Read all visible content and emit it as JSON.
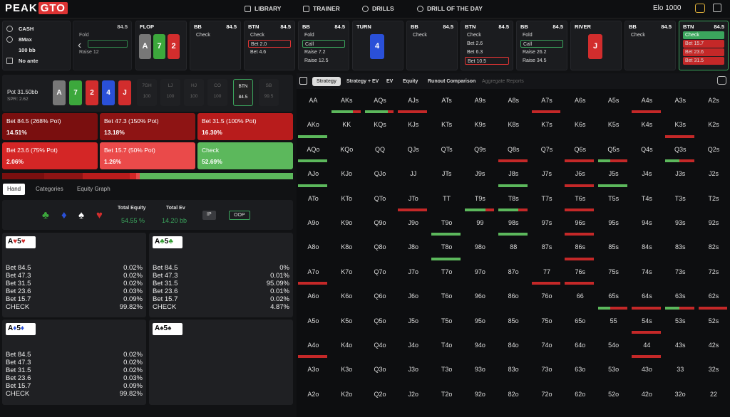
{
  "nav": {
    "logo_left": "PEAK",
    "logo_right": "GTO",
    "items": [
      "LIBRARY",
      "TRAINER",
      "DRILLS",
      "DRILL OF THE DAY"
    ],
    "elo_label": "Elo 1000"
  },
  "game_info": {
    "type": "CASH",
    "players": "8Max",
    "stack": "100 bb",
    "ante": "No ante"
  },
  "tiles": [
    {
      "pos": "",
      "stack": "84.5",
      "actions": [
        "Fold",
        "",
        "Raise 12"
      ]
    },
    {
      "pos": "FLOP",
      "stack": "",
      "cards": [
        "A",
        "7",
        "2"
      ]
    },
    {
      "pos": "BB",
      "stack": "84.5",
      "actions": [
        "Check"
      ]
    },
    {
      "pos": "BTN",
      "stack": "84.5",
      "actions": [
        "Check",
        "Bet 2.0",
        "Bet 4.6"
      ]
    },
    {
      "pos": "BB",
      "stack": "84.5",
      "actions": [
        "Fold",
        "Call",
        "Raise 7.2",
        "Raise 12.5"
      ]
    },
    {
      "pos": "TURN",
      "stack": "",
      "cards": [
        "4"
      ]
    },
    {
      "pos": "BB",
      "stack": "84.5",
      "actions": [
        "Check"
      ]
    },
    {
      "pos": "BTN",
      "stack": "84.5",
      "actions": [
        "Check",
        "Bet 2.6",
        "Bet 6.3",
        "Bet 10.5"
      ]
    },
    {
      "pos": "BB",
      "stack": "84.5",
      "actions": [
        "Fold",
        "Call",
        "Raise 26.2",
        "Raise 34.5"
      ]
    },
    {
      "pos": "RIVER",
      "stack": "",
      "cards": [
        "J"
      ]
    },
    {
      "pos": "BB",
      "stack": "84.5",
      "actions": [
        "Check"
      ]
    },
    {
      "pos": "BTN",
      "stack": "84.5",
      "actions": [
        "Check",
        "Bet 15.7",
        "Bet 23.6",
        "Bet 31.5"
      ]
    }
  ],
  "board": {
    "pot_label": "Pot",
    "pot_value": "31.50bb",
    "spr": "SPR: 2.62",
    "cards": [
      "A",
      "7",
      "2",
      "4",
      "J"
    ]
  },
  "positions": [
    {
      "name": "7GH",
      "stack": "100"
    },
    {
      "name": "LJ",
      "stack": "100"
    },
    {
      "name": "HJ",
      "stack": "100"
    },
    {
      "name": "CO",
      "stack": "100"
    },
    {
      "name": "BTN",
      "stack": "84.5"
    },
    {
      "name": "SB",
      "stack": "99.5"
    }
  ],
  "actions": [
    {
      "label": "Bet 84.5 (268% Pot)",
      "pct": "14.51%",
      "color": "#7a0f0f"
    },
    {
      "label": "Bet 47.3 (150% Pot)",
      "pct": "13.18%",
      "color": "#8e1414"
    },
    {
      "label": "Bet 31.5 (100% Pot)",
      "pct": "16.30%",
      "color": "#b81c1c"
    },
    {
      "label": "Bet 23.6 (75% Pot)",
      "pct": "2.06%",
      "color": "#d42626"
    },
    {
      "label": "Bet 15.7 (50% Pot)",
      "pct": "1.26%",
      "color": "#ea4a4a"
    },
    {
      "label": "Check",
      "pct": "52.69%",
      "color": "#5cb85c"
    }
  ],
  "freq": [
    0.145,
    0.132,
    0.163,
    0.021,
    0.013,
    0.527
  ],
  "subtabs": [
    "Hand",
    "Categories",
    "Equity Graph"
  ],
  "equity": {
    "total_equity_label": "Total Equity",
    "total_equity": "54.55 %",
    "total_ev_label": "Total Ev",
    "total_ev": "14.20 bb",
    "ip": "IP",
    "oop": "OOP"
  },
  "combos": [
    {
      "rank1": "A",
      "suit1": "♥",
      "rank2": "5",
      "suit2": "♥",
      "color": "#d22d2d",
      "rows": [
        [
          "Bet 84.5",
          "0.02%"
        ],
        [
          "Bet 47.3",
          "0.02%"
        ],
        [
          "Bet 31.5",
          "0.02%"
        ],
        [
          "Bet 23.6",
          "0.03%"
        ],
        [
          "Bet 15.7",
          "0.09%"
        ],
        [
          "CHECK",
          "99.82%"
        ]
      ]
    },
    {
      "rank1": "A",
      "suit1": "♣",
      "rank2": "5",
      "suit2": "♣",
      "color": "#2f9a2f",
      "rows": [
        [
          "Bet 84.5",
          "0%"
        ],
        [
          "Bet 47.3",
          "0.01%"
        ],
        [
          "Bet 31.5",
          "95.09%"
        ],
        [
          "Bet 23.6",
          "0.01%"
        ],
        [
          "Bet 15.7",
          "0.02%"
        ],
        [
          "CHECK",
          "4.87%"
        ]
      ]
    },
    {
      "rank1": "A",
      "suit1": "♦",
      "rank2": "5",
      "suit2": "♦",
      "color": "#2a50d8",
      "rows": [
        [
          "Bet 84.5",
          "0.02%"
        ],
        [
          "Bet 47.3",
          "0.02%"
        ],
        [
          "Bet 31.5",
          "0.02%"
        ],
        [
          "Bet 23.6",
          "0.03%"
        ],
        [
          "Bet 15.7",
          "0.09%"
        ],
        [
          "CHECK",
          "99.82%"
        ]
      ]
    },
    {
      "rank1": "A",
      "suit1": "♠",
      "rank2": "5",
      "suit2": "♠",
      "color": "#222",
      "rows": []
    }
  ],
  "right_tabs": [
    "Strategy",
    "Strategy + EV",
    "EV",
    "Equity",
    "Runout Comparison",
    "Aggregate Reports"
  ],
  "grid_labels": [
    [
      "AA",
      "AKs",
      "AQs",
      "AJs",
      "ATs",
      "A9s",
      "A8s",
      "A7s",
      "A6s",
      "A5s",
      "A4s",
      "A3s",
      "A2s"
    ],
    [
      "AKo",
      "KK",
      "KQs",
      "KJs",
      "KTs",
      "K9s",
      "K8s",
      "K7s",
      "K6s",
      "K5s",
      "K4s",
      "K3s",
      "K2s"
    ],
    [
      "AQo",
      "KQo",
      "QQ",
      "QJs",
      "QTs",
      "Q9s",
      "Q8s",
      "Q7s",
      "Q6s",
      "Q5s",
      "Q4s",
      "Q3s",
      "Q2s"
    ],
    [
      "AJo",
      "KJo",
      "QJo",
      "JJ",
      "JTs",
      "J9s",
      "J8s",
      "J7s",
      "J6s",
      "J5s",
      "J4s",
      "J3s",
      "J2s"
    ],
    [
      "ATo",
      "KTo",
      "QTo",
      "JTo",
      "TT",
      "T9s",
      "T8s",
      "T7s",
      "T6s",
      "T5s",
      "T4s",
      "T3s",
      "T2s"
    ],
    [
      "A9o",
      "K9o",
      "Q9o",
      "J9o",
      "T9o",
      "99",
      "98s",
      "97s",
      "96s",
      "95s",
      "94s",
      "93s",
      "92s"
    ],
    [
      "A8o",
      "K8o",
      "Q8o",
      "J8o",
      "T8o",
      "98o",
      "88",
      "87s",
      "86s",
      "85s",
      "84s",
      "83s",
      "82s"
    ],
    [
      "A7o",
      "K7o",
      "Q7o",
      "J7o",
      "T7o",
      "97o",
      "87o",
      "77",
      "76s",
      "75s",
      "74s",
      "73s",
      "72s"
    ],
    [
      "A6o",
      "K6o",
      "Q6o",
      "J6o",
      "T6o",
      "96o",
      "86o",
      "76o",
      "66",
      "65s",
      "64s",
      "63s",
      "62s"
    ],
    [
      "A5o",
      "K5o",
      "Q5o",
      "J5o",
      "T5o",
      "95o",
      "85o",
      "75o",
      "65o",
      "55",
      "54s",
      "53s",
      "52s"
    ],
    [
      "A4o",
      "K4o",
      "Q4o",
      "J4o",
      "T4o",
      "94o",
      "84o",
      "74o",
      "64o",
      "54o",
      "44",
      "43s",
      "42s"
    ],
    [
      "A3o",
      "K3o",
      "Q3o",
      "J3o",
      "T3o",
      "93o",
      "83o",
      "73o",
      "63o",
      "53o",
      "43o",
      "33",
      "32s"
    ],
    [
      "A2o",
      "K2o",
      "Q2o",
      "J2o",
      "T2o",
      "92o",
      "82o",
      "72o",
      "62o",
      "52o",
      "42o",
      "32o",
      "22"
    ]
  ],
  "grid_marks": [
    {
      "label": "AKs",
      "red": 0.25,
      "green": 0.75
    },
    {
      "label": "AQs",
      "red": 0.2,
      "green": 0.8
    },
    {
      "label": "AJs",
      "red": 1,
      "green": 0
    },
    {
      "label": "A7s",
      "red": 1,
      "green": 0
    },
    {
      "label": "A4s",
      "red": 1,
      "green": 0
    },
    {
      "label": "AKo",
      "red": 0,
      "green": 1
    },
    {
      "label": "K3s",
      "red": 1,
      "green": 0
    },
    {
      "label": "AQo",
      "red": 0,
      "green": 1
    },
    {
      "label": "Q8s",
      "red": 1,
      "green": 0
    },
    {
      "label": "Q6s",
      "red": 1,
      "green": 0
    },
    {
      "label": "Q5s",
      "red": 0.6,
      "green": 0.4
    },
    {
      "label": "Q3s",
      "red": 0.5,
      "green": 0.5
    },
    {
      "label": "AJo",
      "red": 0,
      "green": 1
    },
    {
      "label": "J8s",
      "red": 0,
      "green": 1
    },
    {
      "label": "J6s",
      "red": 1,
      "green": 0
    },
    {
      "label": "J5s",
      "red": 0,
      "green": 1
    },
    {
      "label": "T9s",
      "red": 0.3,
      "green": 0.7
    },
    {
      "label": "T8s",
      "red": 0.3,
      "green": 0.7
    },
    {
      "label": "T6s",
      "red": 1,
      "green": 0
    },
    {
      "label": "JTo",
      "red": 1,
      "green": 0
    },
    {
      "label": "T9o",
      "red": 0,
      "green": 1
    },
    {
      "label": "98s",
      "red": 0,
      "green": 1
    },
    {
      "label": "96s",
      "red": 1,
      "green": 0
    },
    {
      "label": "T8o",
      "red": 0,
      "green": 1
    },
    {
      "label": "86s",
      "red": 1,
      "green": 0
    },
    {
      "label": "A7o",
      "red": 1,
      "green": 0
    },
    {
      "label": "77",
      "red": 1,
      "green": 0
    },
    {
      "label": "76s",
      "red": 1,
      "green": 0
    },
    {
      "label": "65s",
      "red": 0.6,
      "green": 0.4
    },
    {
      "label": "64s",
      "red": 1,
      "green": 0
    },
    {
      "label": "63s",
      "red": 0.5,
      "green": 0.5
    },
    {
      "label": "54s",
      "red": 1,
      "green": 0
    },
    {
      "label": "44",
      "red": 1,
      "green": 0
    },
    {
      "label": "A4o",
      "red": 1,
      "green": 0
    },
    {
      "label": "62s",
      "red": 1,
      "green": 0
    }
  ]
}
